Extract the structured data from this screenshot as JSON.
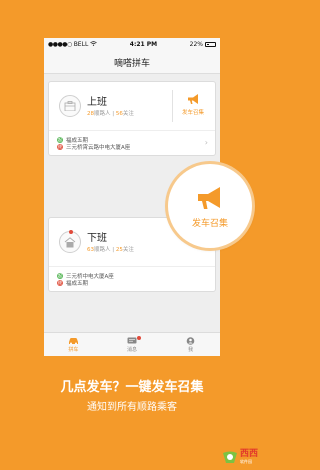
{
  "status_bar": {
    "carrier": "BELL",
    "time": "4:21 PM",
    "battery": "22%"
  },
  "nav": {
    "title": "嘀嗒拼车"
  },
  "cards": [
    {
      "title": "上班",
      "stat1_num": "28",
      "stat1_label": "顺路人",
      "stat2_num": "56",
      "stat2_label": "关注",
      "action_label": "发车召集",
      "route_from": "福成五期",
      "route_to": "三元桥霄云路中电大厦A座",
      "from_mark": "起",
      "to_mark": "终"
    },
    {
      "title": "下班",
      "stat1_num": "63",
      "stat1_label": "顺路人",
      "stat2_num": "25",
      "stat2_label": "关注",
      "action_label": "发车召集",
      "route_from": "三元桥中电大厦A座",
      "route_to": "福成五期",
      "from_mark": "起",
      "to_mark": "终"
    }
  ],
  "tabs": [
    {
      "label": "拼车",
      "icon": "car-icon"
    },
    {
      "label": "消息",
      "icon": "message-icon"
    },
    {
      "label": "我",
      "icon": "profile-icon"
    }
  ],
  "promo": {
    "headline": "几点发车？一键发车召集",
    "subline": "通知到所有顺路乘客"
  },
  "watermark": {
    "main": "西西",
    "sub": "软件园"
  },
  "colors": {
    "accent": "#f49a2a",
    "start": "#5cb85c",
    "end": "#e15b4a",
    "badge": "#e04a3a"
  }
}
